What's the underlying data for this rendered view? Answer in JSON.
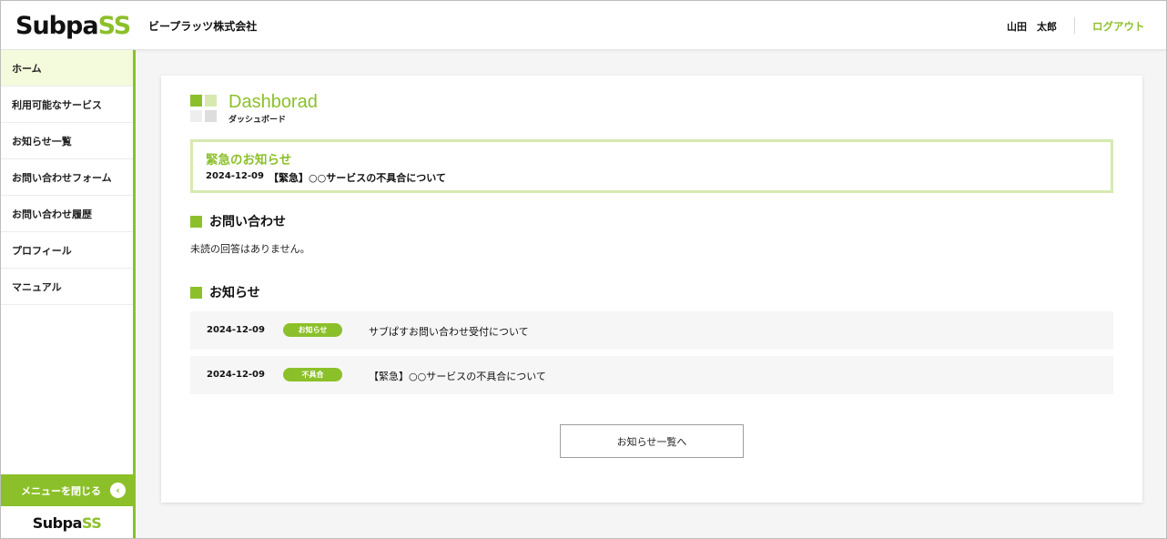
{
  "header": {
    "logo_prefix": "S",
    "logo_main": "ubpa",
    "logo_suffix": "SS",
    "company": "ビープラッツ株式会社",
    "user_name": "山田　太郎",
    "logout_label": "ログアウト"
  },
  "sidebar": {
    "items": [
      {
        "label": "ホーム",
        "active": true
      },
      {
        "label": "利用可能なサービス"
      },
      {
        "label": "お知らせ一覧"
      },
      {
        "label": "お問い合わせフォーム"
      },
      {
        "label": "お問い合わせ履歴"
      },
      {
        "label": "プロフィール"
      },
      {
        "label": "マニュアル"
      }
    ],
    "close_menu_label": "メニューを閉じる",
    "close_icon": "‹",
    "logo_main": "Subpa",
    "logo_suffix": "SS"
  },
  "dashboard": {
    "title": "Dashborad",
    "subtitle": "ダッシュボード",
    "icon_colors": [
      "#8cc02a",
      "#d6eab0",
      "#eeeeee",
      "#dddddd"
    ]
  },
  "urgent": {
    "title": "緊急のお知らせ",
    "date": "2024-12-09",
    "text": "【緊急】○○サービスの不具合について"
  },
  "inquiry": {
    "heading": "お問い合わせ",
    "empty_text": "未読の回答はありません。"
  },
  "news": {
    "heading": "お知らせ",
    "items": [
      {
        "date": "2024-12-09",
        "badge": "お知らせ",
        "title": "サブぱすお問い合わせ受付について"
      },
      {
        "date": "2024-12-09",
        "badge": "不具合",
        "title": "【緊急】○○サービスの不具合について"
      }
    ],
    "more_label": "お知らせ一覧へ"
  },
  "colors": {
    "accent": "#8cc02a",
    "accent_light": "#d6eab0",
    "active_bg": "#f4fadc"
  }
}
